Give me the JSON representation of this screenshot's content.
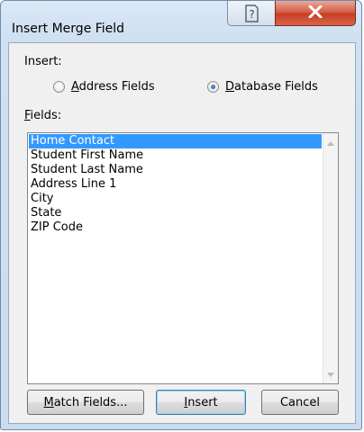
{
  "window": {
    "title": "Insert Merge Field",
    "help_icon": "question-mark-icon",
    "close_icon": "close-x-icon"
  },
  "insert": {
    "label": "Insert:",
    "options": [
      {
        "label_first": "A",
        "label_rest": "ddress Fields",
        "selected": false
      },
      {
        "label_first": "D",
        "label_rest": "atabase Fields",
        "selected": true
      }
    ]
  },
  "fields": {
    "label_first": "F",
    "label_rest": "ields:",
    "items": [
      {
        "label": "Home Contact",
        "selected": true
      },
      {
        "label": "Student First Name",
        "selected": false
      },
      {
        "label": "Student Last Name",
        "selected": false
      },
      {
        "label": "Address Line 1",
        "selected": false
      },
      {
        "label": "City",
        "selected": false
      },
      {
        "label": "State",
        "selected": false
      },
      {
        "label": "ZIP Code",
        "selected": false
      }
    ]
  },
  "buttons": {
    "match_first": "M",
    "match_rest": "atch Fields...",
    "insert_first": "I",
    "insert_rest": "nsert",
    "cancel": "Cancel"
  },
  "colors": {
    "selection": "#3399ff",
    "close": "#c43c22"
  }
}
